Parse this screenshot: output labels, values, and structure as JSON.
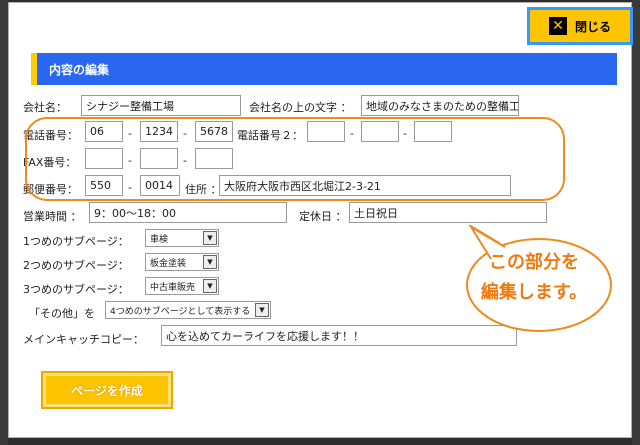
{
  "close_button": {
    "label": "閉じる",
    "icon": "close-icon"
  },
  "section_title": "内容の編集",
  "company": {
    "label": "会社名：",
    "value": "シナジー整備工場",
    "sub_label": "会社名の上の文字 ：",
    "sub_value": "地域のみなさまのための整備工"
  },
  "phone": {
    "label": "電話番号：",
    "parts": [
      "06",
      "1234",
      "5678"
    ],
    "label2": "電話番号２：",
    "parts2": [
      "",
      "",
      ""
    ]
  },
  "fax": {
    "label": "FAX番号：",
    "parts": [
      "",
      "",
      ""
    ]
  },
  "postal": {
    "label": "郵便番号：",
    "parts": [
      "550",
      "0014"
    ]
  },
  "address": {
    "label": "住所 ：",
    "value": "大阪府大阪市西区北堀江2-3-21"
  },
  "hours": {
    "label": "営業時間 ：",
    "value": "9：00〜18：00"
  },
  "holiday": {
    "label": "定休日 ：",
    "value": "土日祝日"
  },
  "subpages": [
    {
      "label": "1つめのサブページ：",
      "value": "車検"
    },
    {
      "label": "2つめのサブページ：",
      "value": "板金塗装"
    },
    {
      "label": "3つめのサブページ：",
      "value": "中古車販売"
    }
  ],
  "other": {
    "label": "「その他」を",
    "value": "4つめのサブページとして表示する"
  },
  "catchcopy": {
    "label": "メインキャッチコピー：",
    "value": "心を込めてカーライフを応援します！！"
  },
  "dash": "-",
  "callout": {
    "line1": "この部分を",
    "line2": "編集します。"
  },
  "submit_label": "ページを作成",
  "colors": {
    "accent_blue": "#2a67f0",
    "accent_yellow": "#ffc400",
    "callout_orange": "#ee8a1e"
  }
}
